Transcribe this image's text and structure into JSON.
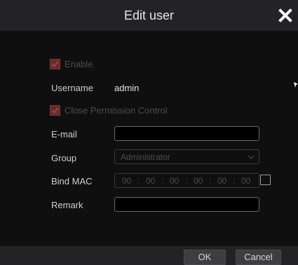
{
  "dialog": {
    "title": "Edit user"
  },
  "form": {
    "enable": {
      "label": "Enable",
      "checked": true
    },
    "username": {
      "label": "Username",
      "value": "admin"
    },
    "close_permission_control": {
      "label": "Close Permission Control",
      "checked": true
    },
    "email": {
      "label": "E-mail",
      "value": ""
    },
    "group": {
      "label": "Group",
      "selected": "Administrator"
    },
    "bind_mac": {
      "label": "Bind MAC",
      "segments": [
        "00",
        "00",
        "00",
        "00",
        "00",
        "00"
      ],
      "bound": false
    },
    "remark": {
      "label": "Remark",
      "value": ""
    }
  },
  "buttons": {
    "ok_label": "OK",
    "cancel_label": "Cancel"
  },
  "icons": {
    "close": "close-icon",
    "check": "check-icon",
    "chevron": "chevron-down-icon",
    "cursor": "mouse-cursor-icon"
  },
  "colors": {
    "title_bar": "#232326",
    "body": "#0f0f10",
    "checkbox_checked": "#6a2a2a",
    "disabled_text": "#4d4d4d"
  }
}
